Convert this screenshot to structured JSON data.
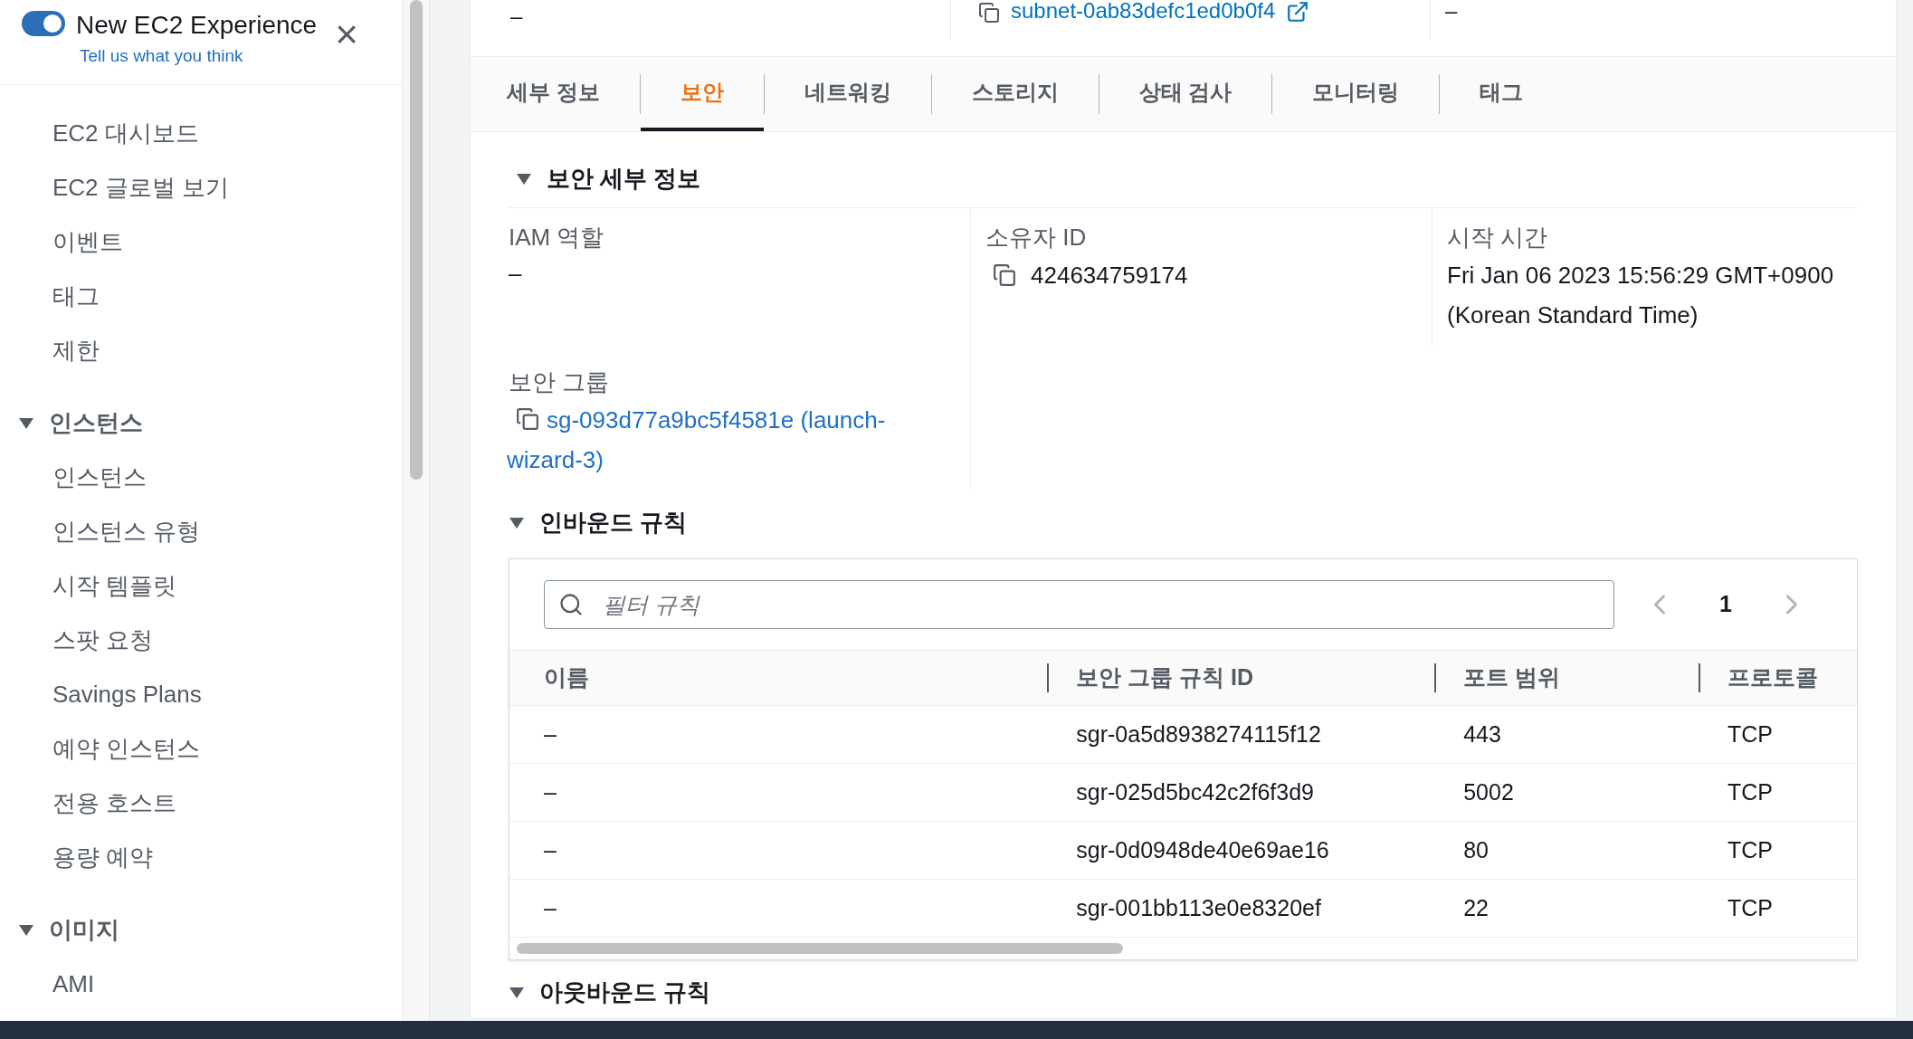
{
  "banner": {
    "toggle_on": true,
    "title": "New EC2 Experience",
    "link": "Tell us what you think",
    "close": "×"
  },
  "sidebar": {
    "items": [
      {
        "label": "EC2 대시보드"
      },
      {
        "label": "EC2 글로벌 보기"
      },
      {
        "label": "이벤트"
      },
      {
        "label": "태그"
      },
      {
        "label": "제한"
      }
    ],
    "sections": [
      {
        "label": "인스턴스",
        "expanded": true,
        "items": [
          {
            "label": "인스턴스"
          },
          {
            "label": "인스턴스 유형"
          },
          {
            "label": "시작 템플릿"
          },
          {
            "label": "스팟 요청"
          },
          {
            "label": "Savings Plans"
          },
          {
            "label": "예약 인스턴스"
          },
          {
            "label": "전용 호스트"
          },
          {
            "label": "용량 예약"
          }
        ]
      },
      {
        "label": "이미지",
        "expanded": true,
        "items": [
          {
            "label": "AMI"
          }
        ]
      }
    ]
  },
  "top_row": {
    "column_1": "–",
    "column_2": "subnet-0ab83defc1ed0b0f4",
    "column_3": "–"
  },
  "tabs": [
    {
      "label": "세부 정보",
      "selected": false
    },
    {
      "label": "보안",
      "selected": true
    },
    {
      "label": "네트워킹",
      "selected": false
    },
    {
      "label": "스토리지",
      "selected": false
    },
    {
      "label": "상태 검사",
      "selected": false
    },
    {
      "label": "모니터링",
      "selected": false
    },
    {
      "label": "태그",
      "selected": false
    }
  ],
  "security_details": {
    "title": "보안 세부 정보",
    "expanded": true,
    "iam_role": {
      "label": "IAM 역할",
      "value": "–"
    },
    "owner_id": {
      "label": "소유자 ID",
      "value": "424634759174"
    },
    "launch_time": {
      "label": "시작 시간",
      "value": "Fri Jan 06 2023 15:56:29 GMT+0900 (Korean Standard Time)"
    },
    "security_group": {
      "label": "보안 그룹",
      "value": "sg-093d77a9bc5f4581e (launch-wizard-3)"
    }
  },
  "inbound_rules": {
    "title": "인바운드 규칙",
    "expanded": true,
    "filter": {
      "placeholder": "필터 규칙"
    },
    "page": "1",
    "columns": [
      "이름",
      "보안 그룹 규칙 ID",
      "포트 범위",
      "프로토콜"
    ],
    "rows": [
      [
        "–",
        "sgr-0a5d8938274115f12",
        "443",
        "TCP"
      ],
      [
        "–",
        "sgr-025d5bc42c2f6f3d9",
        "5002",
        "TCP"
      ],
      [
        "–",
        "sgr-0d0948de40e69ae16",
        "80",
        "TCP"
      ],
      [
        "–",
        "sgr-001bb113e0e8320ef",
        "22",
        "TCP"
      ]
    ]
  },
  "outbound_rules": {
    "title": "아웃바운드 규칙",
    "expanded": true
  }
}
